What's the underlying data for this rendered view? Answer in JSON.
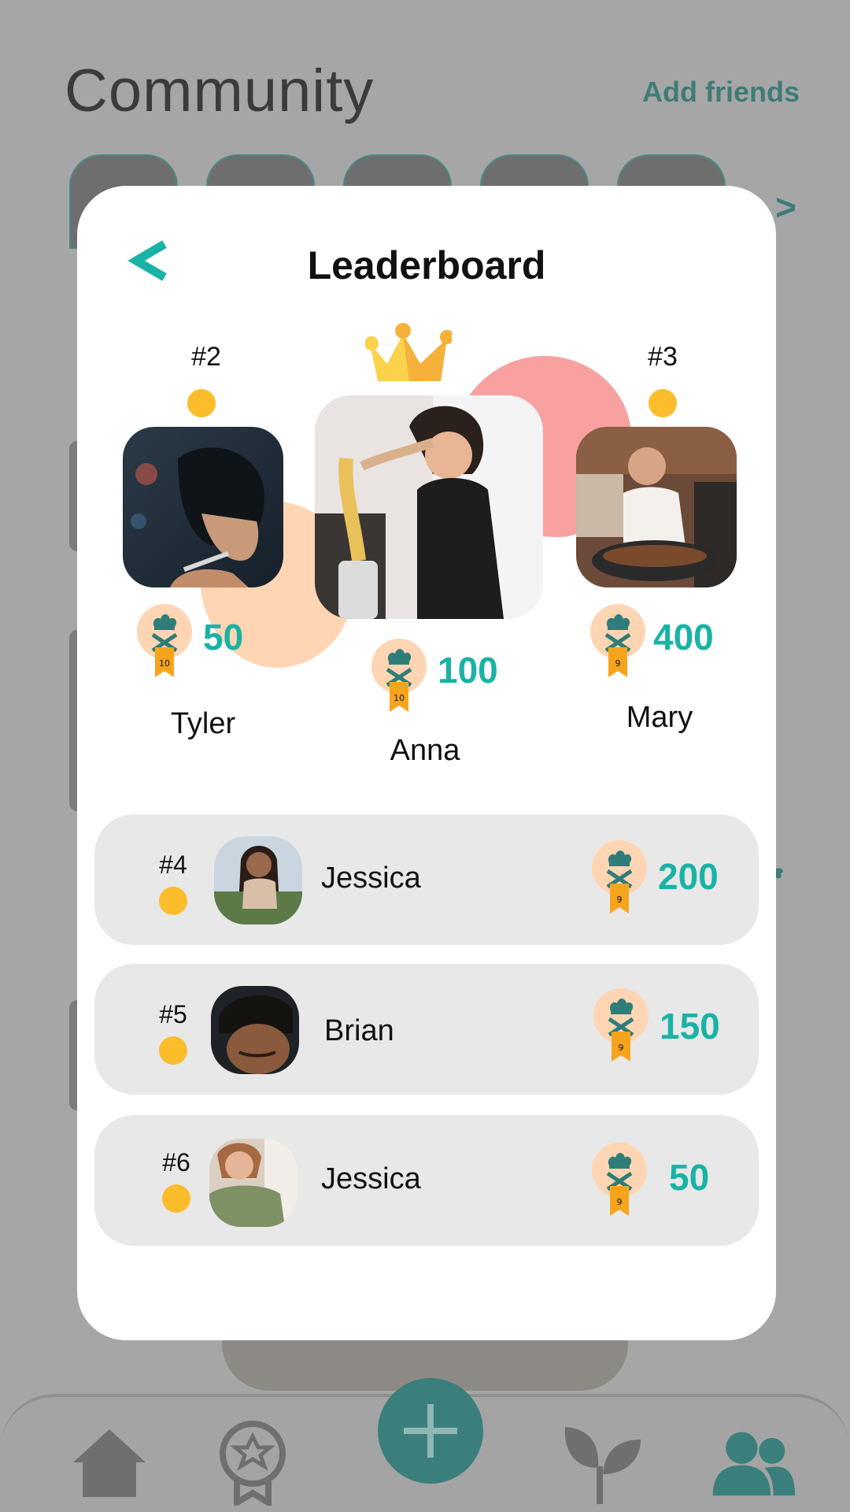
{
  "background": {
    "title": "Community",
    "add_friends": "Add friends",
    "next_glyph": ">"
  },
  "modal": {
    "title": "Leaderboard",
    "back_glyph": "<"
  },
  "podium": [
    {
      "rank": "#2",
      "name": "Tyler",
      "score": "50",
      "badge_level": "10"
    },
    {
      "rank": "#1",
      "name": "Anna",
      "score": "100",
      "badge_level": "10"
    },
    {
      "rank": "#3",
      "name": "Mary",
      "score": "400",
      "badge_level": "9"
    }
  ],
  "list": [
    {
      "rank": "#4",
      "name": "Jessica",
      "score": "200",
      "badge_level": "9"
    },
    {
      "rank": "#5",
      "name": "Brian",
      "score": "150",
      "badge_level": "9"
    },
    {
      "rank": "#6",
      "name": "Jessica",
      "score": "50",
      "badge_level": "9"
    }
  ],
  "nav": {
    "items": [
      "home-icon",
      "badge-icon",
      "add-icon",
      "plant-icon",
      "community-icon"
    ],
    "active": "community-icon"
  },
  "colors": {
    "accent": "#19b3a6",
    "rank_dot": "#fbbd2c",
    "badge_circle": "#ffd5b3",
    "ribbon": "#f7a41d",
    "chef_icon": "#2f7d78"
  }
}
